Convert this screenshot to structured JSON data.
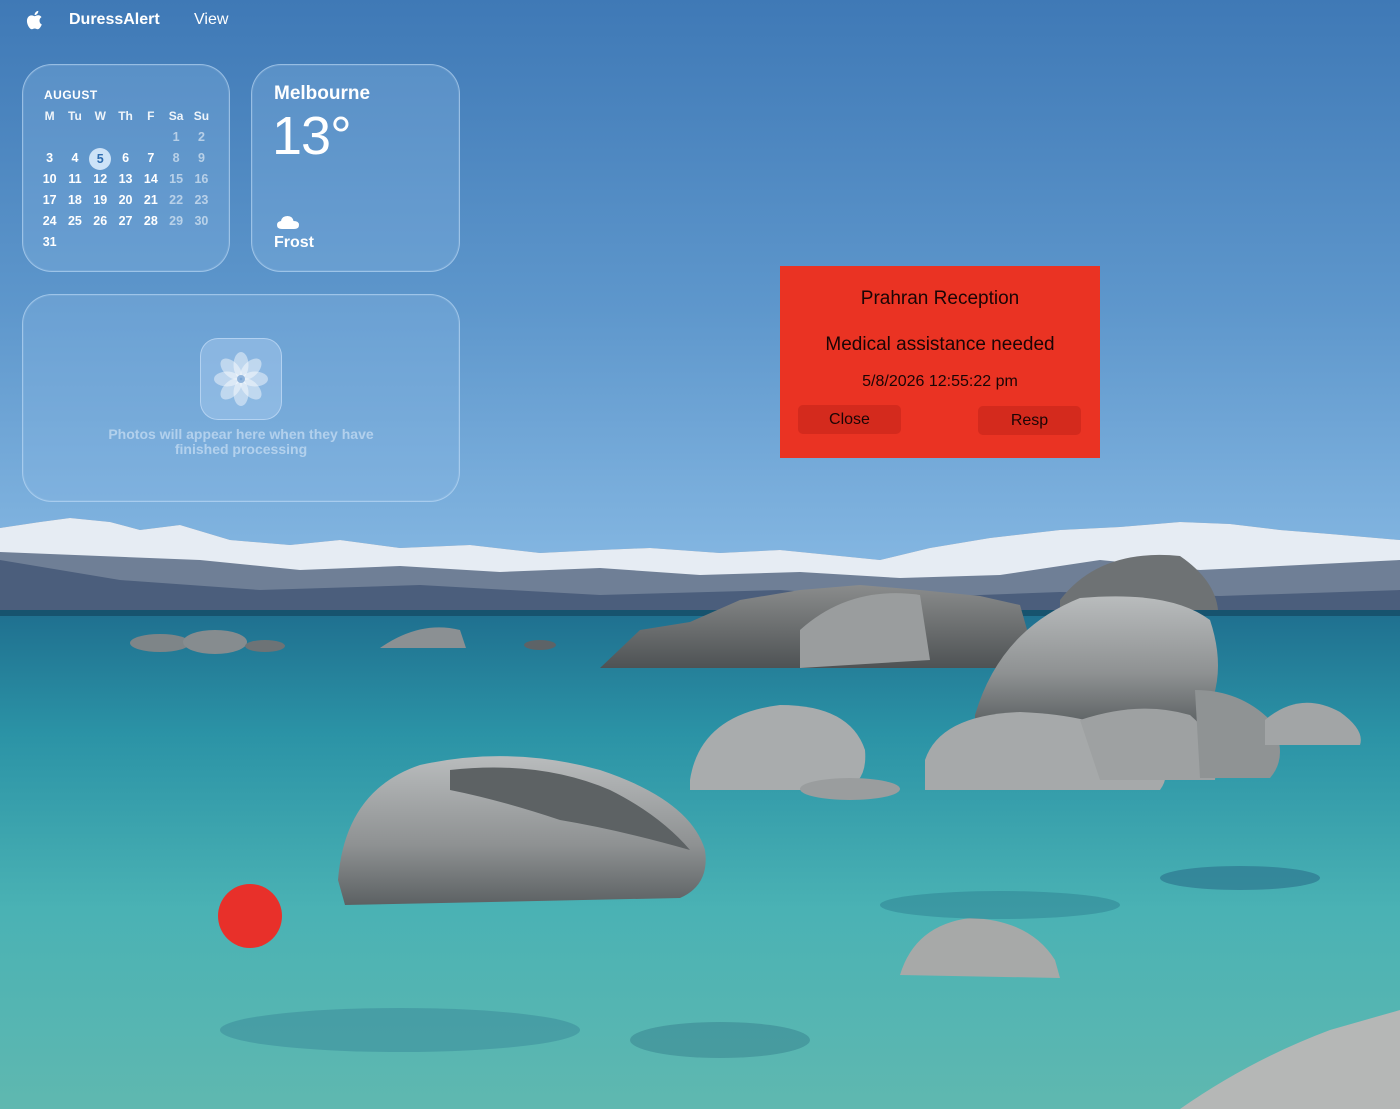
{
  "menubar": {
    "app_name": "DuressAlert",
    "menu_view": "View",
    "icon": "apple-logo-icon"
  },
  "calendar": {
    "month": "AUGUST",
    "weekdays": [
      "M",
      "Tu",
      "W",
      "Th",
      "F",
      "Sa",
      "Su"
    ],
    "weeks": [
      [
        "",
        "",
        "",
        "",
        "",
        "1",
        "2"
      ],
      [
        "3",
        "4",
        "5",
        "6",
        "7",
        "8",
        "9"
      ],
      [
        "10",
        "11",
        "12",
        "13",
        "14",
        "15",
        "16"
      ],
      [
        "17",
        "18",
        "19",
        "20",
        "21",
        "22",
        "23"
      ],
      [
        "24",
        "25",
        "26",
        "27",
        "28",
        "29",
        "30"
      ],
      [
        "31",
        "",
        "",
        "",
        "",
        "",
        ""
      ]
    ],
    "today": "5"
  },
  "weather": {
    "city": "Melbourne",
    "temperature": "13°",
    "condition": "Frost",
    "condition_icon": "cloud-icon"
  },
  "photos": {
    "message": "Photos will appear here when they have finished processing",
    "icon": "photos-flower-icon"
  },
  "alert": {
    "location": "Prahran Reception",
    "message": "Medical assistance needed",
    "timestamp": "5/8/2026 12:55:22 pm",
    "close_label": "Close",
    "respond_label": "Resp",
    "background_color": "#ea3323"
  },
  "indicator": {
    "color": "#e8302a",
    "icon": "red-dot-indicator"
  }
}
